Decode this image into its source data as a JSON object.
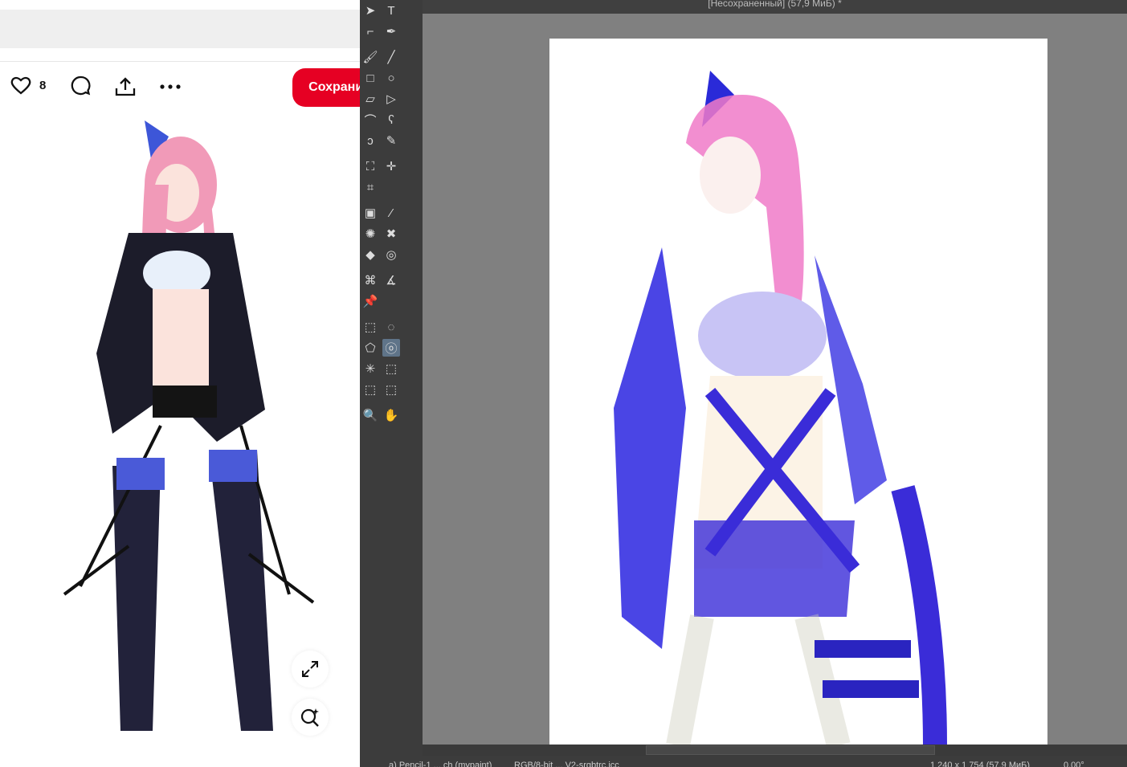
{
  "pin": {
    "like_count": "8",
    "save_label": "Сохранить"
  },
  "krita": {
    "title": "[Несохраненный]  (57,9 МиБ) *",
    "status": {
      "brush": "a) Pencil-1 ... ch (mypaint)",
      "color_space": "RGB/8-bit ... V2-srgbtrc.icc",
      "image_size": "1 240 x 1 754 (57,9 МиБ)",
      "rotation": "0,00°"
    }
  },
  "colors": {
    "accent": "#e60023",
    "toolbox": "#3c3c3c",
    "canvas_bg": "#808080"
  }
}
